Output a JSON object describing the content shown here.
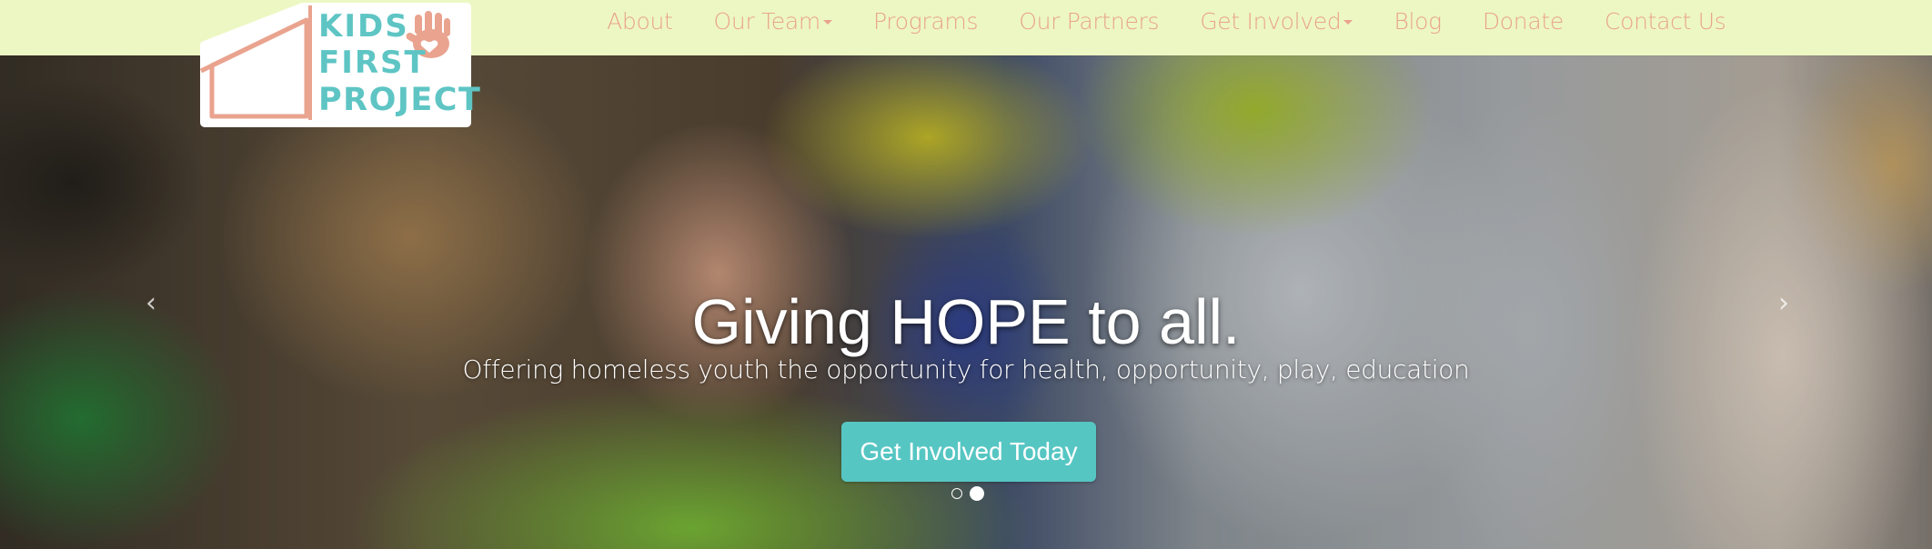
{
  "brand": {
    "logo_text": "KIDS FIRST PROJECT",
    "logo_words": [
      "KIDS",
      "FIRST",
      "PROJECT"
    ],
    "colors": {
      "teal": "#5ec5c4",
      "coral": "#e9a38e",
      "nav_bg": "#edf7c3"
    }
  },
  "nav": {
    "items": [
      {
        "label": "About",
        "dropdown": false
      },
      {
        "label": "Our Team",
        "dropdown": true
      },
      {
        "label": "Programs",
        "dropdown": false
      },
      {
        "label": "Our Partners",
        "dropdown": false
      },
      {
        "label": "Get Involved",
        "dropdown": true
      },
      {
        "label": "Blog",
        "dropdown": false
      },
      {
        "label": "Donate",
        "dropdown": false
      },
      {
        "label": "Contact Us",
        "dropdown": false
      }
    ]
  },
  "hero": {
    "headline": "Giving HOPE to all.",
    "subheadline": "Offering homeless youth the opportunity for health, opportunity, play, education",
    "cta_label": "Get Involved Today",
    "prev_icon": "chevron-left-icon",
    "next_icon": "chevron-right-icon",
    "prev_glyph": "‹",
    "next_glyph": "›",
    "slide_count": 2,
    "active_slide": 2
  }
}
